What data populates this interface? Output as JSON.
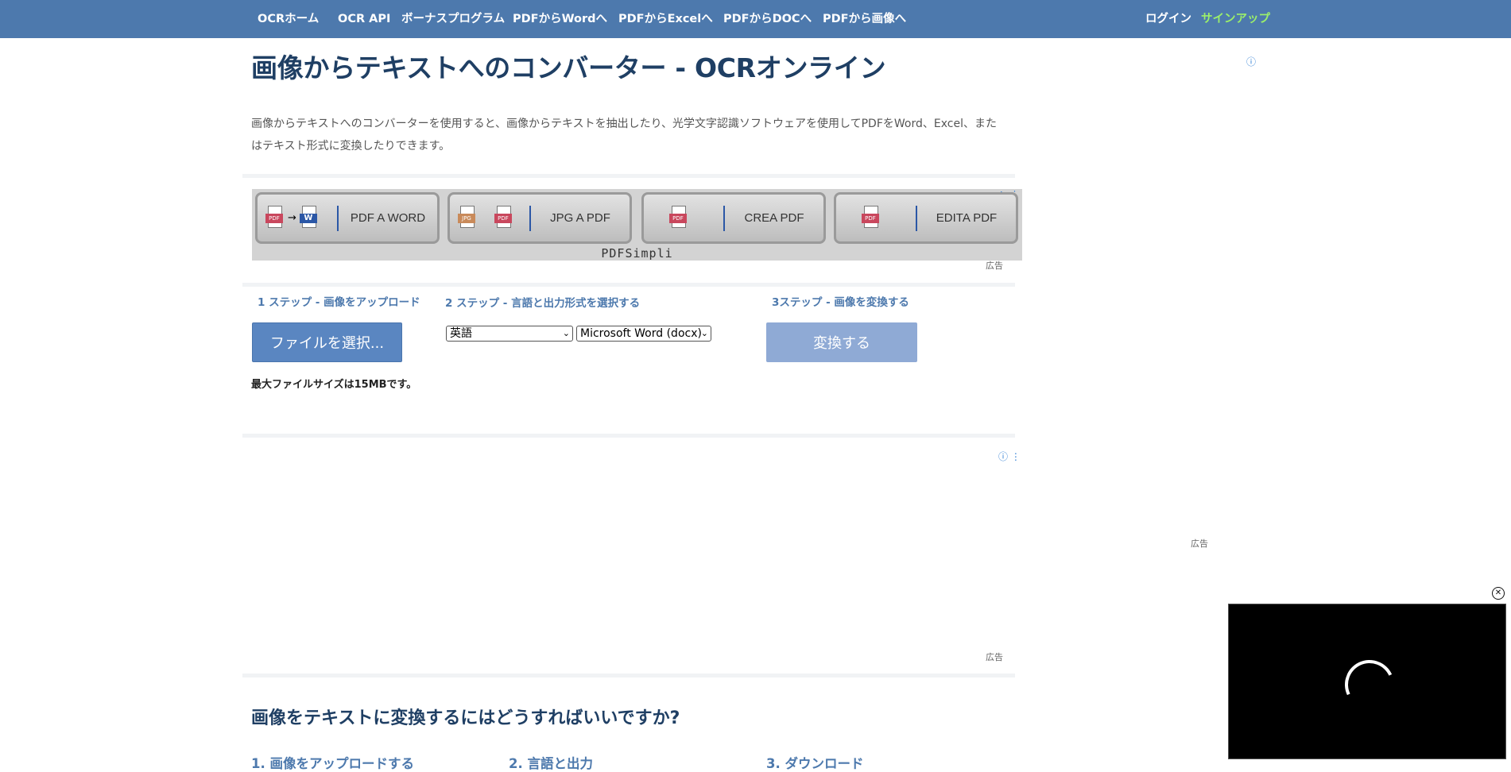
{
  "nav": {
    "items": [
      "OCRホーム",
      "OCR API",
      "ボーナスプログラム",
      "PDFからWordへ",
      "PDFからExcelへ",
      "PDFからDOCへ",
      "PDFから画像へ"
    ],
    "login": "ログイン",
    "signup": "サインアップ"
  },
  "page": {
    "title": "画像からテキストへのコンバーター - OCRオンライン",
    "intro": "画像からテキストへのコンバーターを使用すると、画像からテキストを抽出したり、光学文字認識ソフトウェアを使用してPDFをWord、Excel、またはテキスト形式に変換したりできます。"
  },
  "ad_banner": {
    "buttons": [
      {
        "label": "PDF A WORD",
        "icons": [
          "PDF",
          "→",
          "W"
        ]
      },
      {
        "label": "JPG A PDF",
        "icons": [
          "JPG",
          "PDF"
        ]
      },
      {
        "label": "CREA PDF",
        "icons": [
          "PDF"
        ]
      },
      {
        "label": "EDITA PDF",
        "icons": [
          "PDF"
        ]
      }
    ],
    "brand": "PDFSimpli",
    "ad_label": "広告"
  },
  "steps": {
    "step1_title": "1 ステップ - 画像をアップロード",
    "step2_title": "2 ステップ - 言語と出力形式を選択する",
    "step3_title": "3ステップ - 画像を変換する",
    "choose_file": "ファイルを選択...",
    "language_value": "英語",
    "format_value": "Microsoft Word (docx)",
    "convert": "変換する",
    "max_size": "最大ファイルサイズは15MBです。"
  },
  "ads": {
    "label": "広告",
    "info_icon": "ⓘ"
  },
  "howto": {
    "title": "画像をテキストに変換するにはどうすればいいですか?",
    "steps": [
      "1. 画像をアップロードする",
      "2. 言語と出力",
      "3. ダウンロード"
    ]
  },
  "colors": {
    "nav_bg": "#4d79ad",
    "signup": "#9cf06a",
    "title": "#1f3f64",
    "accent": "#4d79ad"
  }
}
